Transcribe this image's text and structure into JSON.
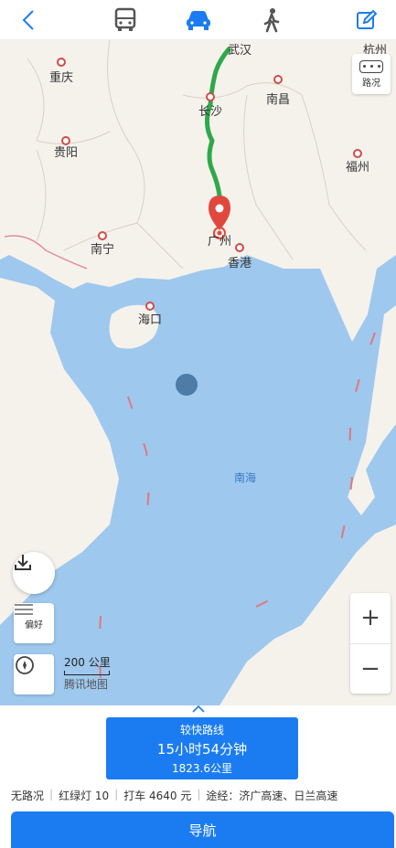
{
  "map": {
    "cities": [
      {
        "id": "wuhan",
        "name": "武汉"
      },
      {
        "id": "chongqing",
        "name": "重庆"
      },
      {
        "id": "nanchang",
        "name": "南昌"
      },
      {
        "id": "changsha",
        "name": "长沙"
      },
      {
        "id": "guiyang",
        "name": "贵阳"
      },
      {
        "id": "fuzhou",
        "name": "福州"
      },
      {
        "id": "nanning",
        "name": "南宁"
      },
      {
        "id": "guangzhou",
        "name": "广州"
      },
      {
        "id": "hongkong",
        "name": "香港"
      },
      {
        "id": "haikou",
        "name": "海口"
      },
      {
        "id": "hangzhou",
        "name": "杭州"
      }
    ],
    "sea_label": "南海",
    "traffic_label": "路况",
    "preference_label": "偏好",
    "scale_label": "200 公里",
    "brand": "腾讯地图",
    "zoom_in": "+",
    "zoom_out": "−"
  },
  "route": {
    "tag": "较快路线",
    "duration": "15小时54分钟",
    "distance": "1823.6公里",
    "info": {
      "traffic": "无路况",
      "lights": "红绿灯 10",
      "taxi": "打车 4640 元",
      "via": "途经：济广高速、日兰高速"
    }
  },
  "navigate_label": "导航",
  "colors": {
    "accent": "#1b7cf2",
    "route": "#2fa84a",
    "pin": "#e0483e"
  }
}
